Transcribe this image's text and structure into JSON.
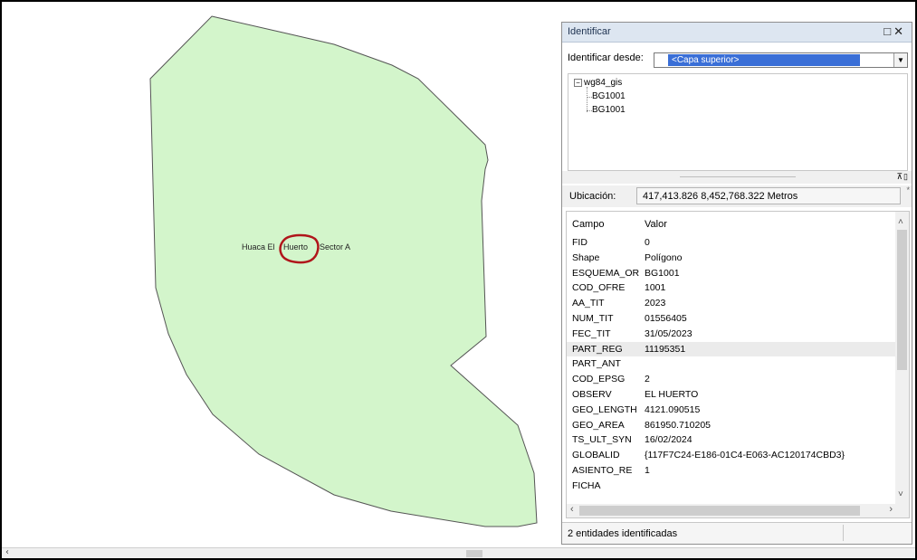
{
  "map": {
    "label_left": "Huaca El",
    "label_mid": "Huerto",
    "label_right": "Sector A",
    "polygon_fill": "#d3f5cb",
    "polygon_stroke": "#555555",
    "highlight_color": "#b0161b"
  },
  "identify": {
    "title": "Identificar",
    "identify_from_label": "Identificar desde:",
    "identify_from_value": "<Capa superior>",
    "tree": {
      "root": "wg84_gis",
      "children": [
        "BG1001",
        "BG1001"
      ]
    },
    "location_label": "Ubicación:",
    "location_value": "417,413.826  8,452,768.322 Metros",
    "columns": {
      "field": "Campo",
      "value": "Valor"
    },
    "rows": [
      {
        "field": "FID",
        "value": "0"
      },
      {
        "field": "Shape",
        "value": "Polígono"
      },
      {
        "field": "ESQUEMA_OR",
        "value": "BG1001"
      },
      {
        "field": "COD_OFRE",
        "value": "1001"
      },
      {
        "field": "AA_TIT",
        "value": "2023"
      },
      {
        "field": "NUM_TIT",
        "value": "01556405"
      },
      {
        "field": "FEC_TIT",
        "value": "31/05/2023"
      },
      {
        "field": "PART_REG",
        "value": "11195351"
      },
      {
        "field": "PART_ANT",
        "value": ""
      },
      {
        "field": "COD_EPSG",
        "value": "2"
      },
      {
        "field": "OBSERV",
        "value": "EL HUERTO"
      },
      {
        "field": "GEO_LENGTH",
        "value": "4121.090515"
      },
      {
        "field": "GEO_AREA",
        "value": "861950.710205"
      },
      {
        "field": "TS_ULT_SYN",
        "value": "16/02/2024"
      },
      {
        "field": "GLOBALID",
        "value": "{117F7C24-E186-01C4-E063-AC120174CBD3}"
      },
      {
        "field": "ASIENTO_RE",
        "value": "1"
      },
      {
        "field": "FICHA",
        "value": ""
      }
    ],
    "selected_field": "PART_REG",
    "status": "2 entidades identificadas"
  }
}
